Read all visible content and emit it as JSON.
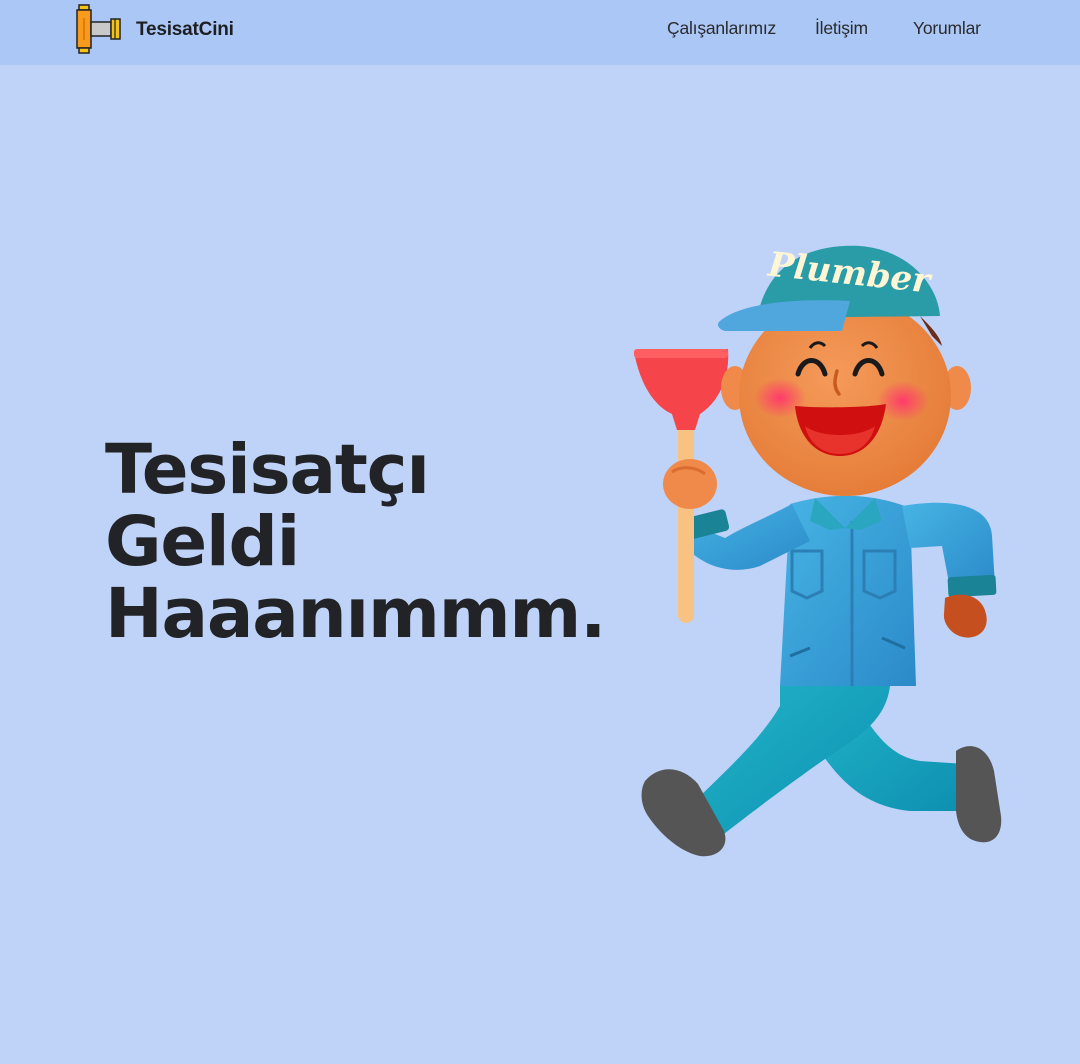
{
  "brand": {
    "name": "TesisatCini",
    "logo_icon": "pipe-fitting-icon"
  },
  "nav": {
    "items": [
      {
        "label": "Çalışanlarımız"
      },
      {
        "label": "İletişim"
      },
      {
        "label": "Yorumlar"
      }
    ]
  },
  "hero": {
    "title_lines": [
      "Tesisatçı",
      "Geldi",
      "Haaanımmm."
    ],
    "illustration": {
      "name": "plumber-illustration",
      "cap_text": "Plumber"
    }
  },
  "colors": {
    "page_background": "#bfd2f8",
    "navbar_background": "#abc7f5",
    "text": "#222326",
    "cap_teal": "#2a9ca8",
    "uniform_blue": "#3aa6d8",
    "plunger_red": "#f5454a",
    "skin_orange": "#f08a4b"
  }
}
